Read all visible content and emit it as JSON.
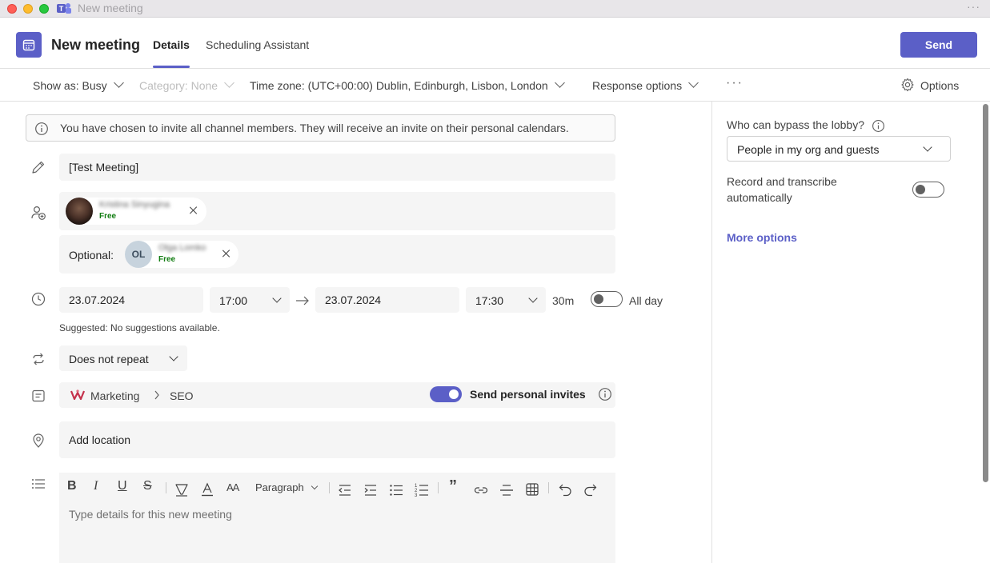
{
  "window": {
    "title": "New meeting"
  },
  "header": {
    "title": "New meeting",
    "tabs": [
      {
        "label": "Details"
      },
      {
        "label": "Scheduling Assistant"
      }
    ],
    "send_label": "Send"
  },
  "toolbar": {
    "show_as": "Show as: Busy",
    "category": "Category: None",
    "timezone": "Time zone:  (UTC+00:00) Dublin, Edinburgh, Lisbon, London",
    "response_options": "Response options",
    "more": "···",
    "options": "Options"
  },
  "banner": {
    "text": "You have chosen to invite all channel members. They will receive an invite on their personal calendars."
  },
  "form": {
    "title_value": "[Test Meeting]",
    "required_attendee": {
      "name": "Kristina Sinyugina",
      "status": "Free"
    },
    "optional_label": "Optional:",
    "optional_attendee": {
      "initials": "OL",
      "name": "Olga Lomko",
      "status": "Free"
    },
    "start_date": "23.07.2024",
    "start_time": "17:00",
    "end_date": "23.07.2024",
    "end_time": "17:30",
    "duration": "30m",
    "all_day_label": "All day",
    "suggested": "Suggested: No suggestions available.",
    "repeat": "Does not repeat",
    "team": "Marketing",
    "channel": "SEO",
    "personal_invites_label": "Send personal invites",
    "location_placeholder": "Add location",
    "editor": {
      "paragraph": "Paragraph",
      "placeholder": "Type details for this new meeting"
    }
  },
  "side_panel": {
    "lobby_label": "Who can bypass the lobby?",
    "lobby_value": "People in my org and guests",
    "record_label_line1": "Record and transcribe",
    "record_label_line2": "automatically",
    "more_options": "More options"
  },
  "colors": {
    "accent": "#5b5fc7",
    "free": "#107c10"
  }
}
